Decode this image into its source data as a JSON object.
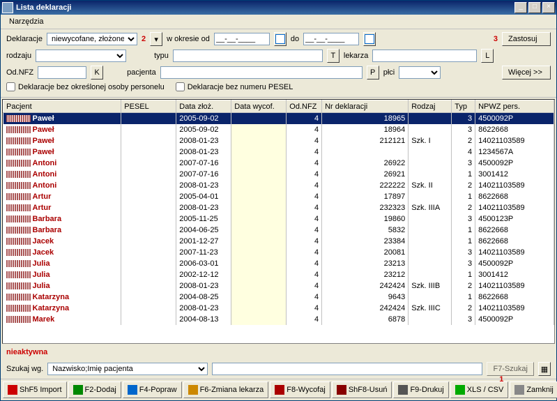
{
  "title": "Lista deklaracji",
  "menu": {
    "tools": "Narzędzia"
  },
  "filters": {
    "declLabel": "Deklaracje",
    "declValue": "niewycofane, złożone",
    "marker2": "2",
    "periodFrom": "w okresie od",
    "periodFromVal": "__-__-____",
    "periodTo": "do",
    "periodToVal": "__-__-____",
    "marker3": "3",
    "apply": "Zastosuj",
    "kindLabel": "rodzaju",
    "typeLabel": "typu",
    "doctorLabel": "lekarza",
    "odNfzLabel": "Od.NFZ",
    "patientLabel": "pacjenta",
    "sexLabel": "płci",
    "more": "Więcej >>",
    "chk1": "Deklaracje bez określonej osoby personelu",
    "chk2": "Deklaracje bez numeru PESEL",
    "kBtn": "K",
    "tBtn": "T",
    "lBtn": "L",
    "pBtn": "P"
  },
  "columns": [
    "Pacjent",
    "PESEL",
    "Data złoż.",
    "Data wycof.",
    "Od.NFZ",
    "Nr deklaracji",
    "Rodzaj",
    "Typ",
    "NPWZ pers."
  ],
  "rows": [
    {
      "name": "Paweł",
      "pesel": "",
      "dz": "2005-09-02",
      "dw": "",
      "od": "4",
      "nr": "18965",
      "rodz": "",
      "typ": "3",
      "np": "4500092P"
    },
    {
      "name": "Paweł",
      "pesel": "",
      "dz": "2005-09-02",
      "dw": "",
      "od": "4",
      "nr": "18964",
      "rodz": "",
      "typ": "3",
      "np": "8622668"
    },
    {
      "name": "Paweł",
      "pesel": "",
      "dz": "2008-01-23",
      "dw": "",
      "od": "4",
      "nr": "212121",
      "rodz": "Szk. I",
      "typ": "2",
      "np": "14021103589"
    },
    {
      "name": "Paweł",
      "pesel": "",
      "dz": "2008-01-23",
      "dw": "",
      "od": "4",
      "nr": "",
      "rodz": "",
      "typ": "4",
      "np": "1234567A"
    },
    {
      "name": "Antoni",
      "pesel": "",
      "dz": "2007-07-16",
      "dw": "",
      "od": "4",
      "nr": "26922",
      "rodz": "",
      "typ": "3",
      "np": "4500092P"
    },
    {
      "name": "Antoni",
      "pesel": "",
      "dz": "2007-07-16",
      "dw": "",
      "od": "4",
      "nr": "26921",
      "rodz": "",
      "typ": "1",
      "np": "3001412"
    },
    {
      "name": "Antoni",
      "pesel": "",
      "dz": "2008-01-23",
      "dw": "",
      "od": "4",
      "nr": "222222",
      "rodz": "Szk. II",
      "typ": "2",
      "np": "14021103589"
    },
    {
      "name": "Artur",
      "pesel": "",
      "dz": "2005-04-01",
      "dw": "",
      "od": "4",
      "nr": "17897",
      "rodz": "",
      "typ": "1",
      "np": "8622668"
    },
    {
      "name": "Artur",
      "pesel": "",
      "dz": "2008-01-23",
      "dw": "",
      "od": "4",
      "nr": "232323",
      "rodz": "Szk. IIIA",
      "typ": "2",
      "np": "14021103589"
    },
    {
      "name": "Barbara",
      "pesel": "",
      "dz": "2005-11-25",
      "dw": "",
      "od": "4",
      "nr": "19860",
      "rodz": "",
      "typ": "3",
      "np": "4500123P"
    },
    {
      "name": "Barbara",
      "pesel": "",
      "dz": "2004-06-25",
      "dw": "",
      "od": "4",
      "nr": "5832",
      "rodz": "",
      "typ": "1",
      "np": "8622668"
    },
    {
      "name": "Jacek",
      "pesel": "",
      "dz": "2001-12-27",
      "dw": "",
      "od": "4",
      "nr": "23384",
      "rodz": "",
      "typ": "1",
      "np": "8622668"
    },
    {
      "name": "Jacek",
      "pesel": "",
      "dz": "2007-11-23",
      "dw": "",
      "od": "4",
      "nr": "20081",
      "rodz": "",
      "typ": "3",
      "np": "14021103589"
    },
    {
      "name": "Julia",
      "pesel": "",
      "dz": "2006-03-01",
      "dw": "",
      "od": "4",
      "nr": "23213",
      "rodz": "",
      "typ": "3",
      "np": "4500092P"
    },
    {
      "name": "Julia",
      "pesel": "",
      "dz": "2002-12-12",
      "dw": "",
      "od": "4",
      "nr": "23212",
      "rodz": "",
      "typ": "1",
      "np": "3001412"
    },
    {
      "name": "Julia",
      "pesel": "",
      "dz": "2008-01-23",
      "dw": "",
      "od": "4",
      "nr": "242424",
      "rodz": "Szk. IIIB",
      "typ": "2",
      "np": "14021103589"
    },
    {
      "name": "Katarzyna",
      "pesel": "",
      "dz": "2004-08-25",
      "dw": "",
      "od": "4",
      "nr": "9643",
      "rodz": "",
      "typ": "1",
      "np": "8622668"
    },
    {
      "name": "Katarzyna",
      "pesel": "",
      "dz": "2008-01-23",
      "dw": "",
      "od": "4",
      "nr": "242424",
      "rodz": "Szk. IIIC",
      "typ": "2",
      "np": "14021103589"
    },
    {
      "name": "Marek",
      "pesel": "",
      "dz": "2004-08-13",
      "dw": "",
      "od": "4",
      "nr": "6878",
      "rodz": "",
      "typ": "3",
      "np": "4500092P"
    }
  ],
  "status": "nieaktywna",
  "search": {
    "label": "Szukaj wg.",
    "field": "Nazwisko;Imię pacjenta",
    "btn": "F7-Szukaj"
  },
  "footer": {
    "marker1": "1",
    "import": "ShF5 Import",
    "add": "F2-Dodaj",
    "edit": "F4-Popraw",
    "change": "F6-Zmiana lekarza",
    "cancel": "F8-Wycofaj",
    "del": "ShF8-Usuń",
    "print": "F9-Drukuj",
    "xls": "XLS / CSV",
    "close": "Zamknij"
  }
}
